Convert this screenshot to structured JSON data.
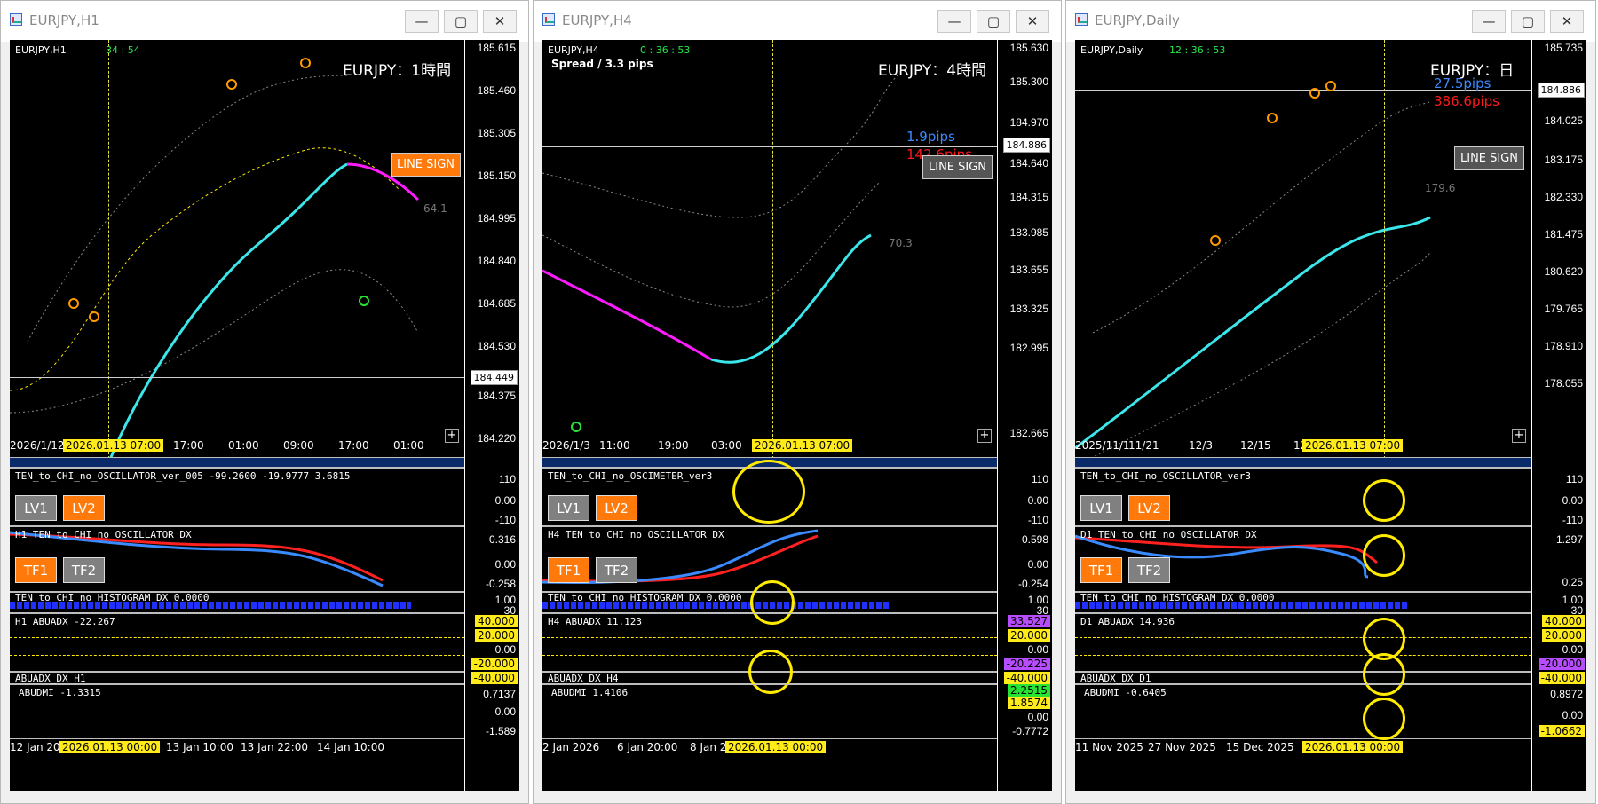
{
  "windows": [
    {
      "title": "EURJPY,H1",
      "symbol_label": "EURJPY,H1",
      "timer": "34 : 54",
      "big_title": "EURJPY：1時間",
      "line_sign": "LINE SIGN",
      "side_value": "64.1",
      "price_axis": [
        "185.615",
        "185.460",
        "185.305",
        "185.150",
        "184.995",
        "184.840",
        "184.685",
        "184.530",
        "184.375",
        "184.220"
      ],
      "current_price": "184.449",
      "time_axis": [
        "2026/1/12",
        "17:00",
        "01:00",
        "09:00",
        "17:00",
        "01:00"
      ],
      "cursor_time": "2026.01.13 07:00",
      "osc_label": "TEN_to_CHI_no_OSCILLATOR_ver_005 -99.2600 -19.9777 3.6815",
      "osc_axis": [
        "110",
        "0.00",
        "-110"
      ],
      "lv1": "LV1",
      "lv2": "LV2",
      "dx_label": "H1 TEN_to_CHI_no_OSCILLATOR_DX",
      "dx_axis": [
        "0.316",
        "0.00",
        "-0.258"
      ],
      "tf1": "TF1",
      "tf2": "TF2",
      "hist_label": "TEN_to_CHI_no_HISTOGRAM_DX 0.0000",
      "hist_axis": [
        "1.00",
        "30"
      ],
      "abuadx_label": "H1 ABUADX -22.267",
      "abuadx_axis": [
        "40.000",
        "20.000",
        "0.00",
        "-20.000",
        "-40.000"
      ],
      "abuadx_dx_label": "ABUADX_DX H1",
      "abudmi_label": "ABUDMI -1.3315",
      "abudmi_axis": [
        "0.7137",
        "0.00",
        "-1.589"
      ],
      "bottom_axis": [
        "12 Jan 202",
        "13 Jan 10:00",
        "13 Jan 22:00",
        "14 Jan 10:00"
      ],
      "bottom_cursor": "2026.01.13 00:00"
    },
    {
      "title": "EURJPY,H4",
      "symbol_label": "EURJPY,H4",
      "timer": "0 : 36 : 53",
      "spread": "Spread / 3.3 pips",
      "big_title": "EURJPY：4時間",
      "pips_blue": "1.9pips",
      "pips_red": "142.6pips",
      "line_sign": "LINE SIGN",
      "side_value": "70.3",
      "price_axis": [
        "185.630",
        "185.300",
        "184.970",
        "184.640",
        "184.315",
        "183.985",
        "183.655",
        "183.325",
        "182.995",
        "182.665"
      ],
      "current_price": "184.886",
      "time_axis": [
        "2026/1/3",
        "11:00",
        "19:00",
        "03:00"
      ],
      "cursor_time": "2026.01.13 07:00",
      "osc_label": "TEN_to_CHI_no_OSCIMETER_ver3",
      "osc_axis": [
        "110",
        "0.00",
        "-110"
      ],
      "lv1": "LV1",
      "lv2": "LV2",
      "dx_label": "H4 TEN_to_CHI_no_OSCILLATOR_DX",
      "dx_axis": [
        "0.598",
        "0.00",
        "-0.254"
      ],
      "tf1": "TF1",
      "tf2": "TF2",
      "hist_label": "TEN_to_CHI_no_HISTOGRAM_DX 0.0000",
      "hist_axis": [
        "1.00",
        "30"
      ],
      "abuadx_label": "H4 ABUADX 11.123",
      "abuadx_axis": [
        "33.527",
        "20.000",
        "0.00",
        "-20.225",
        "-40.000"
      ],
      "abuadx_dx_label": "ABUADX_DX H4",
      "abudmi_label": "ABUDMI 1.4106",
      "abudmi_axis": [
        "2.2515",
        "1.8574",
        "0.00",
        "-0.7772"
      ],
      "bottom_axis": [
        "2 Jan 2026",
        "6 Jan 20:00",
        "8 Jan 20"
      ],
      "bottom_cursor": "2026.01.13 00:00"
    },
    {
      "title": "EURJPY,Daily",
      "symbol_label": "EURJPY,Daily",
      "timer": "12 : 36 : 53",
      "big_title": "EURJPY：日",
      "pips_blue": "27.5pips",
      "pips_red": "386.6pips",
      "line_sign": "LINE SIGN",
      "side_value": "179.6",
      "price_axis": [
        "185.735",
        "184.886",
        "184.025",
        "183.175",
        "182.330",
        "181.475",
        "180.620",
        "179.765",
        "178.910",
        "178.055"
      ],
      "current_price": "184.886",
      "time_axis": [
        "2025/11/1",
        "11/21",
        "12/3",
        "12/15",
        "12/26"
      ],
      "cursor_time": "2026.01.13 07:00",
      "osc_label": "TEN_to_CHI_no_OSCILLATOR_ver3",
      "osc_axis": [
        "110",
        "0.00",
        "-110"
      ],
      "lv1": "LV1",
      "lv2": "LV2",
      "dx_label": "D1 TEN_to_CHI_no_OSCILLATOR_DX",
      "dx_axis": [
        "1.297",
        "0.25"
      ],
      "tf1": "TF1",
      "tf2": "TF2",
      "hist_label": "TEN_to_CHI_no_HISTOGRAM_DX 0.0000",
      "hist_axis": [
        "1.00",
        "30"
      ],
      "abuadx_label": "D1 ABUADX 14.936",
      "abuadx_axis": [
        "40.000",
        "20.000",
        "0.00",
        "-20.000",
        "-40.000"
      ],
      "abuadx_dx_label": "ABUADX_DX D1",
      "abudmi_label": "ABUDMI -0.6405",
      "abudmi_axis": [
        "0.8972",
        "0.00",
        "-1.0662"
      ],
      "bottom_axis": [
        "11 Nov 2025",
        "27 Nov 2025",
        "15 Dec 2025"
      ],
      "bottom_cursor": "2026.01.13 00:00"
    }
  ],
  "window_buttons": {
    "minimize": "—",
    "maximize": "▢",
    "close": "✕"
  },
  "colors": {
    "bull": "#2f8bef",
    "bear": "#ff1a1a",
    "ma": "#3be6ea",
    "ma_falling": "#ff1aff",
    "highlight": "#ffeb00",
    "button_orange": "#ff7a0a"
  }
}
